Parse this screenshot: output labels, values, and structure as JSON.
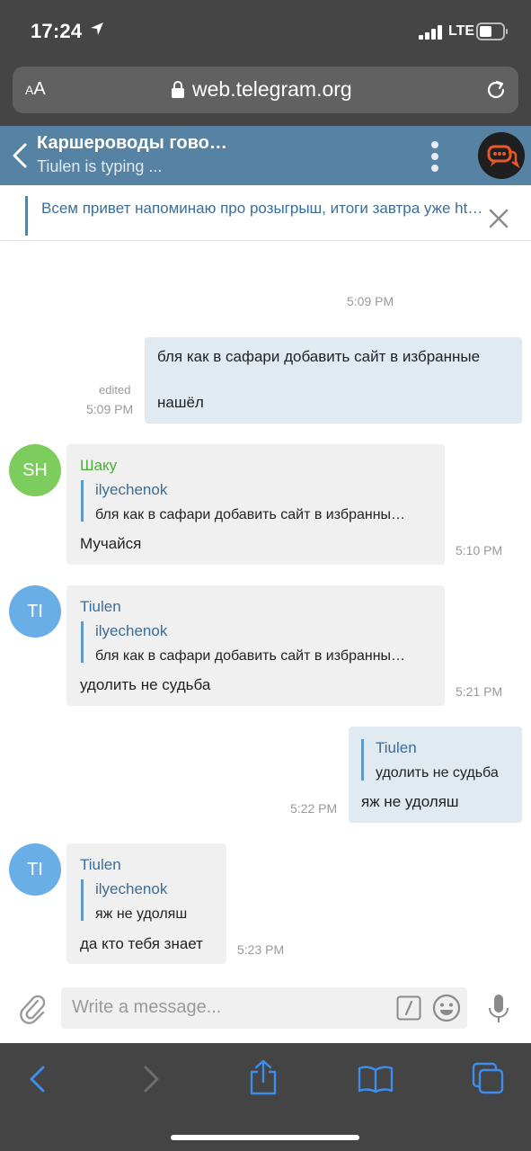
{
  "status_bar": {
    "time": "17:24",
    "network": "LTE"
  },
  "safari": {
    "text_size_label": "AA",
    "url": "web.telegram.org"
  },
  "chat": {
    "title": "Каршероводы гово…",
    "status": "Tiulen is typing ..."
  },
  "pinned": {
    "text": "Всем привет напоминаю про розыгрыш, итоги завтра уже ht…"
  },
  "messages": {
    "day_time": "5:09 PM",
    "m1": {
      "line1": "бля как в сафари добавить сайт в избранные",
      "line2": "нашёл",
      "edited": "edited",
      "time": "5:09 PM"
    },
    "m2": {
      "avatar": "SH",
      "sender": "Шаку",
      "reply_name": "ilyechenok",
      "reply_text": "бля как в сафари добавить сайт в избранны…",
      "text": "Мучайся",
      "time": "5:10 PM"
    },
    "m3": {
      "avatar": "TI",
      "sender": "Tiulen",
      "reply_name": "ilyechenok",
      "reply_text": "бля как в сафари добавить сайт в избранны…",
      "text": "удолить не судьба",
      "time": "5:21 PM"
    },
    "m4": {
      "reply_name": "Tiulen",
      "reply_text": "удолить не судьба",
      "text": "яж не удоляш",
      "time": "5:22 PM"
    },
    "m5": {
      "avatar": "TI",
      "sender": "Tiulen",
      "reply_name": "ilyechenok",
      "reply_text": "яж не удоляш",
      "text": "да кто тебя знает",
      "time": "5:23 PM"
    }
  },
  "composer": {
    "placeholder": "Write a message..."
  },
  "colors": {
    "header": "#5682a3",
    "outgoing_bubble": "#e1e9f1",
    "incoming_bubble": "#f0f0f0",
    "avatar_sh": "#7dcc5e",
    "avatar_ti": "#6aaee8",
    "sender_green": "#4caf3a",
    "sender_blue": "#3a6d99"
  }
}
